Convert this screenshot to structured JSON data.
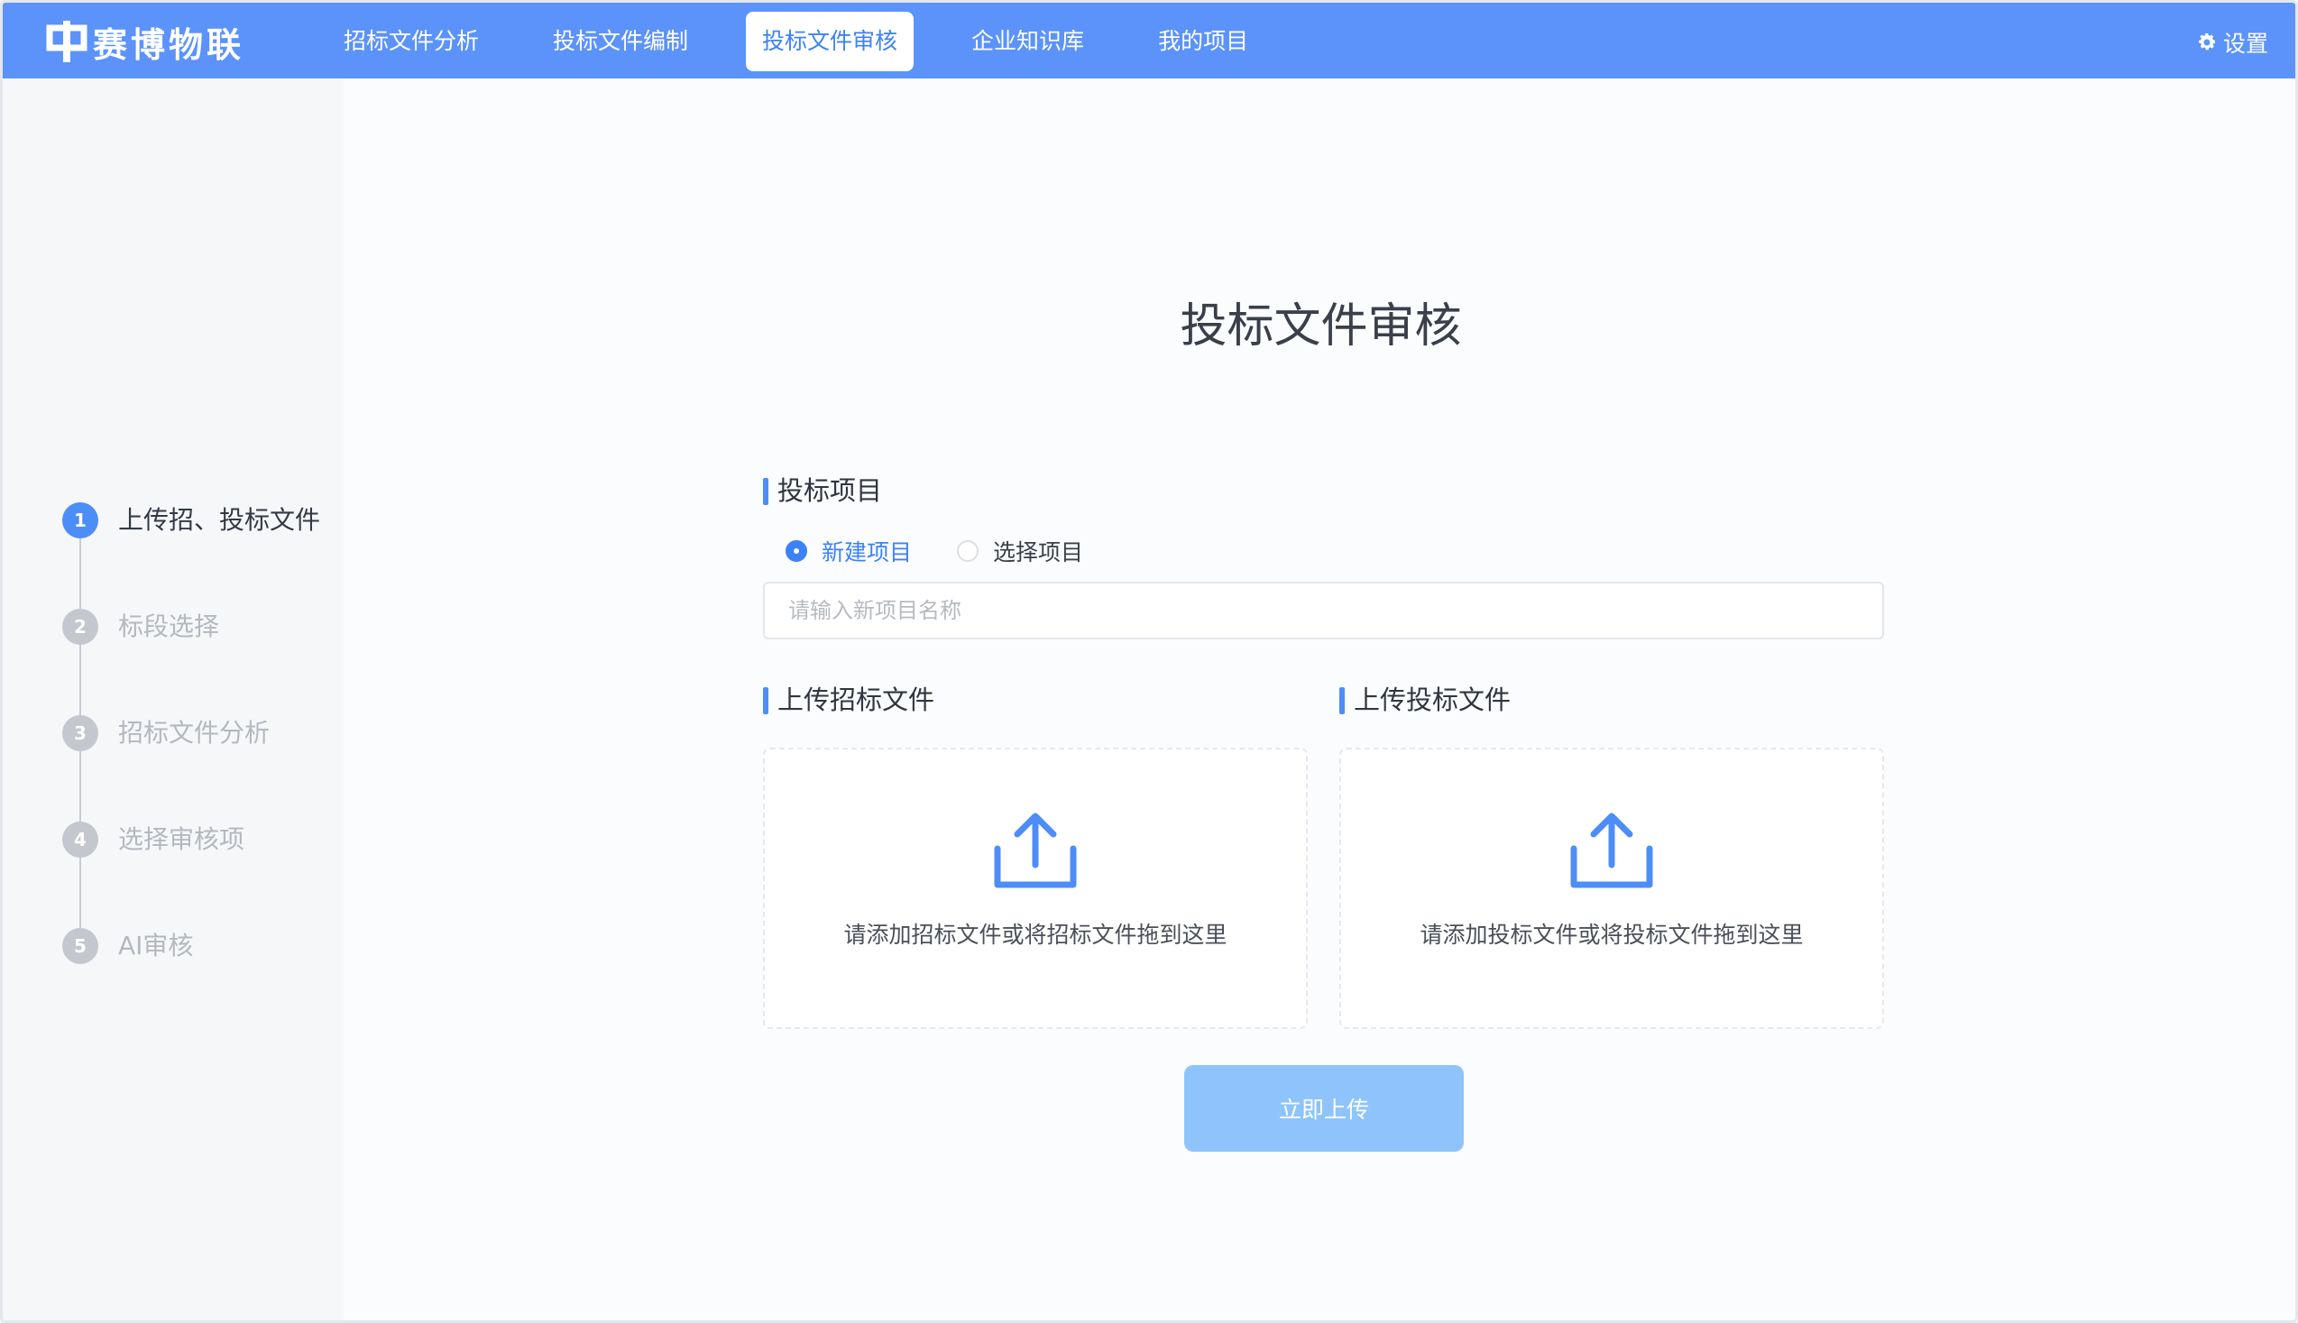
{
  "brand": {
    "name": "赛博物联"
  },
  "nav": {
    "items": [
      {
        "label": "招标文件分析"
      },
      {
        "label": "投标文件编制"
      },
      {
        "label": "投标文件审核",
        "active": true
      },
      {
        "label": "企业知识库"
      },
      {
        "label": "我的项目"
      }
    ],
    "settings_label": "设置"
  },
  "steps": [
    {
      "num": "1",
      "label": "上传招、投标文件",
      "active": true
    },
    {
      "num": "2",
      "label": "标段选择"
    },
    {
      "num": "3",
      "label": "招标文件分析"
    },
    {
      "num": "4",
      "label": "选择审核项"
    },
    {
      "num": "5",
      "label": "AI审核"
    }
  ],
  "main": {
    "title": "投标文件审核",
    "project_section": "投标项目",
    "radio_new": "新建项目",
    "radio_select": "选择项目",
    "name_placeholder": "请输入新项目名称",
    "tender_section": "上传招标文件",
    "bid_section": "上传投标文件",
    "tender_drop_text": "请添加招标文件或将招标文件拖到这里",
    "bid_drop_text": "请添加投标文件或将投标文件拖到这里",
    "upload_button": "立即上传"
  },
  "colors": {
    "topbar": "#5b93fb",
    "accent": "#3b82f6",
    "upload_button": "#8ec4fb"
  }
}
